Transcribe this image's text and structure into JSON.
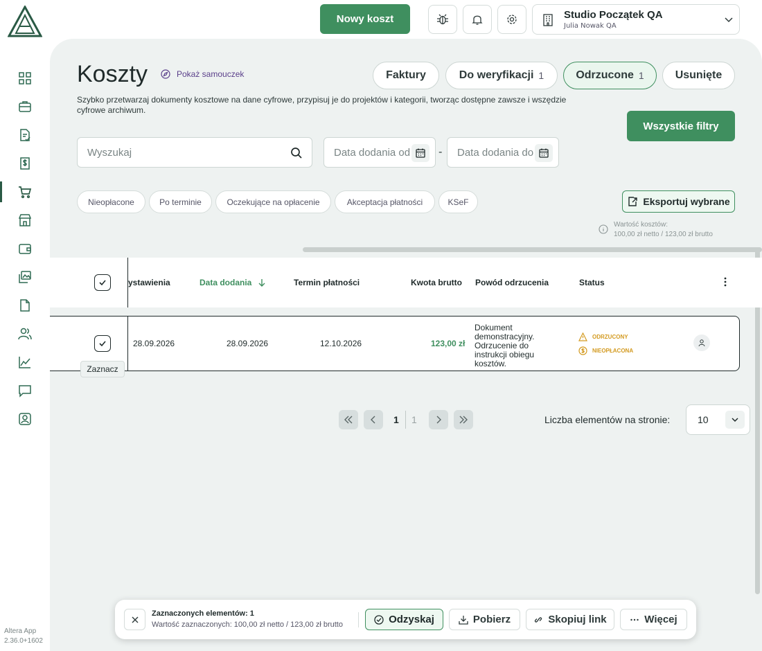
{
  "app": {
    "version_line1": "Altera App",
    "version_line2": "2.36.0+1602"
  },
  "topbar": {
    "new_cost_label": "Nowy koszt",
    "org_name": "Studio Początek QA",
    "org_user": "Julia Nowak QA"
  },
  "sidebar": {
    "items": [
      {
        "icon": "dashboard-icon"
      },
      {
        "icon": "briefcase-icon"
      },
      {
        "icon": "document-check-icon"
      },
      {
        "icon": "invoice-dollar-icon"
      },
      {
        "icon": "cart-icon",
        "active": true
      },
      {
        "icon": "store-icon"
      },
      {
        "icon": "wallet-icon"
      },
      {
        "icon": "gallery-icon"
      },
      {
        "icon": "file-icon"
      },
      {
        "icon": "people-icon"
      },
      {
        "icon": "chart-icon"
      },
      {
        "icon": "chat-icon"
      },
      {
        "icon": "contact-icon"
      }
    ]
  },
  "page": {
    "title": "Koszty",
    "tutorial_label": "Pokaż samouczek",
    "description": "Szybko przetwarzaj dokumenty kosztowe na dane cyfrowe, przypisuj je do projektów i kategorii, tworząc dostępne zawsze i wszędzie cyfrowe archiwum."
  },
  "tabs": [
    {
      "label": "Faktury",
      "count": ""
    },
    {
      "label": "Do weryfikacji",
      "count": "1"
    },
    {
      "label": "Odrzucone",
      "count": "1",
      "selected": true
    },
    {
      "label": "Usunięte",
      "count": ""
    }
  ],
  "filters": {
    "all_filters_label": "Wszystkie filtry",
    "search_placeholder": "Wyszukaj",
    "date_from_placeholder": "Data dodania od",
    "date_to_placeholder": "Data dodania do",
    "date_separator": "-",
    "chips": [
      "Nieopłacone",
      "Po terminie",
      "Oczekujące na opłacenie",
      "Akceptacja płatności",
      "KSeF"
    ],
    "export_label": "Eksportuj wybrane",
    "cost_value_label": "Wartość kosztów:",
    "cost_value": "100,00 zł netto / 123,00 zł brutto"
  },
  "table": {
    "columns": {
      "issue_date": "ystawienia",
      "added_date": "Data dodania",
      "due_date": "Termin płatności",
      "gross": "Kwota brutto",
      "reason": "Powód odrzucenia",
      "status": "Status"
    },
    "rows": [
      {
        "issue_date": "28.09.2026",
        "added_date": "28.09.2026",
        "due_date": "12.10.2026",
        "gross": "123,00 zł",
        "reason": "Dokument demonstracyjny. Odrzucenie do instrukcji obiegu kosztów.",
        "status_primary": "ODRZUCONY",
        "status_secondary": "NIEOPŁACONA"
      }
    ],
    "tooltip": "Zaznacz"
  },
  "pagination": {
    "current_page": "1",
    "total_pages": "1",
    "per_page_label": "Liczba elementów na stronie:",
    "per_page_value": "10"
  },
  "selection_bar": {
    "title": "Zaznaczonych elementów: 1",
    "subtitle": "Wartość zaznaczonych: 100,00 zł netto / 123,00 zł brutto",
    "recover_label": "Odzyskaj",
    "download_label": "Pobierz",
    "copy_link_label": "Skopiuj link",
    "more_label": "Więcej"
  },
  "colors": {
    "accent": "#3f8f5f",
    "warning": "#d39a20",
    "background": "#eef2f1"
  }
}
